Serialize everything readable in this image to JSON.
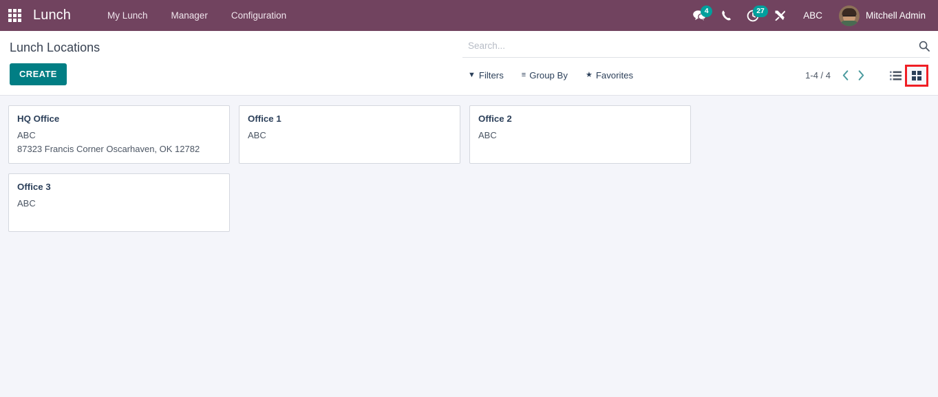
{
  "navbar": {
    "apps_icon": "apps-grid-icon",
    "brand": "Lunch",
    "menu_items": [
      {
        "label": "My Lunch"
      },
      {
        "label": "Manager"
      },
      {
        "label": "Configuration"
      }
    ],
    "messages": {
      "icon": "messages-icon",
      "count": "4"
    },
    "voip": {
      "icon": "phone-icon"
    },
    "activities": {
      "icon": "activities-clock-icon",
      "count": "27"
    },
    "debug": {
      "icon": "tools-wrench-icon"
    },
    "company": "ABC",
    "user": {
      "name": "Mitchell Admin",
      "avatar_icon": "user-avatar"
    },
    "accent_color": "#71435f",
    "badge_color": "#00a09d"
  },
  "control_panel": {
    "title": "Lunch Locations",
    "create_label": "CREATE",
    "create_color": "#017e84",
    "search": {
      "placeholder": "Search...",
      "value": "",
      "icon": "search-icon"
    },
    "facets": [
      {
        "label": "Filters",
        "icon": "filter-funnel-icon",
        "glyph": "▼"
      },
      {
        "label": "Group By",
        "icon": "group-by-icon",
        "glyph": "≡"
      },
      {
        "label": "Favorites",
        "icon": "favorites-star-icon",
        "glyph": "★"
      }
    ],
    "pager": {
      "count": "1-4 / 4",
      "previous_icon": "chevron-left-icon",
      "next_icon": "chevron-right-icon",
      "previous_glyph": "‹",
      "next_glyph": "›",
      "arrow_color": "#4a9a9e"
    },
    "views": [
      {
        "name": "list",
        "icon": "list-view-icon",
        "active": false,
        "highlighted": false
      },
      {
        "name": "kanban",
        "icon": "kanban-view-icon",
        "active": true,
        "highlighted": true
      }
    ],
    "highlight_color": "#f01e24"
  },
  "kanban": {
    "cards": [
      {
        "title": "HQ Office",
        "company": "ABC",
        "address": "87323 Francis Corner Oscarhaven, OK 12782"
      },
      {
        "title": "Office 1",
        "company": "ABC",
        "address": ""
      },
      {
        "title": "Office 2",
        "company": "ABC",
        "address": ""
      },
      {
        "title": "Office 3",
        "company": "ABC",
        "address": ""
      }
    ]
  }
}
